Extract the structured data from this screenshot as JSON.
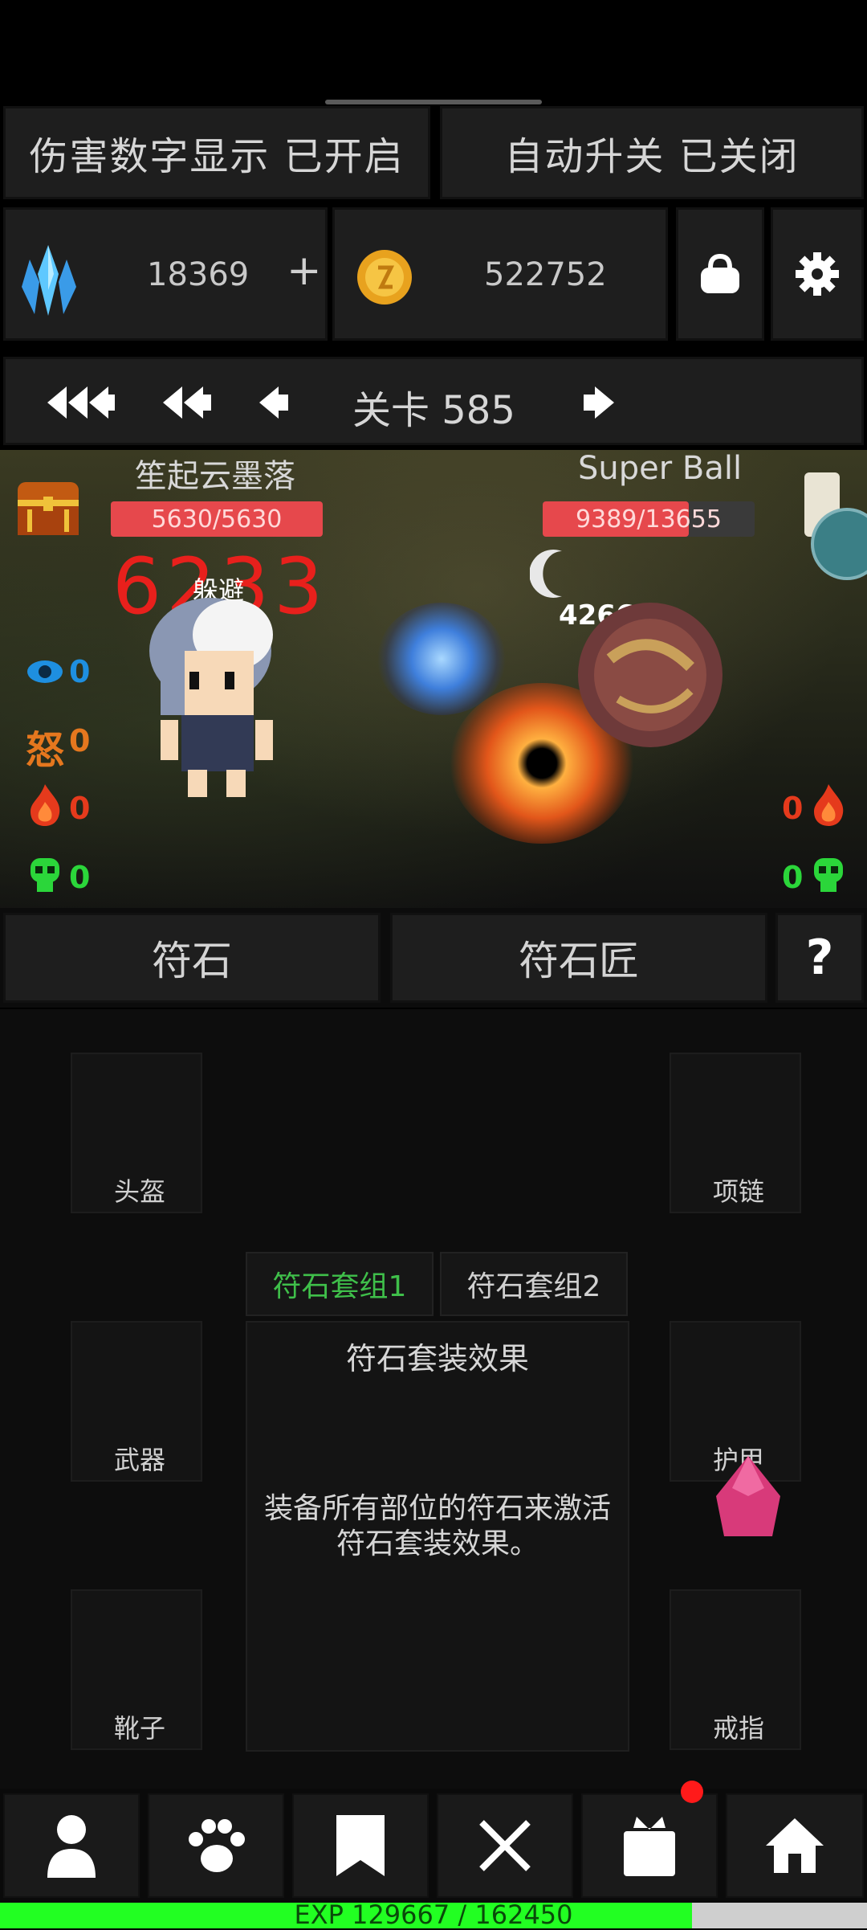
{
  "toggles": {
    "damage_display": "伤害数字显示 已开启",
    "auto_switch": "自动升关 已关闭"
  },
  "resources": {
    "crystal_icon": "blue-crystal-icon",
    "crystal_value": "18369",
    "plus": "+",
    "coin_icon": "gold-coin-icon",
    "coin_value": "522752"
  },
  "stage": {
    "label": "关卡 585"
  },
  "player": {
    "name": "笙起云墨落",
    "hp": "5630/5630",
    "damage_number": "6233",
    "dodge": "躲避",
    "stats": {
      "eye": "0",
      "rage_label": "怒",
      "rage": "0",
      "fire": "0",
      "skull": "0"
    }
  },
  "enemy": {
    "name": "Super Ball",
    "hp": "9389/13655",
    "hp_fraction": 0.688,
    "damage_number": "4266",
    "stats": {
      "fire": "0",
      "skull": "0"
    }
  },
  "tabs": {
    "rune": "符石",
    "rune_smith": "符石匠",
    "help": "?"
  },
  "equipment": {
    "helmet": "头盔",
    "necklace": "项链",
    "weapon": "武器",
    "armor": "护甲",
    "boots": "靴子",
    "ring": "戒指"
  },
  "rune_sets": {
    "set1": "符石套组1",
    "set2": "符石套组2",
    "effect_title": "符石套装效果",
    "effect_desc": "装备所有部位的符石来激活符石套装效果。"
  },
  "bottom_nav": [
    "character-icon",
    "pet-paw-icon",
    "bookmark-icon",
    "swords-icon",
    "gift-icon",
    "home-icon"
  ],
  "exp": {
    "label": "EXP 129667 / 162450",
    "fraction": 0.798
  },
  "colors": {
    "hp_red": "#e6484c",
    "active_green": "#3fbf4a",
    "exp_green": "#22ff22",
    "damage_red": "#e8201c"
  }
}
